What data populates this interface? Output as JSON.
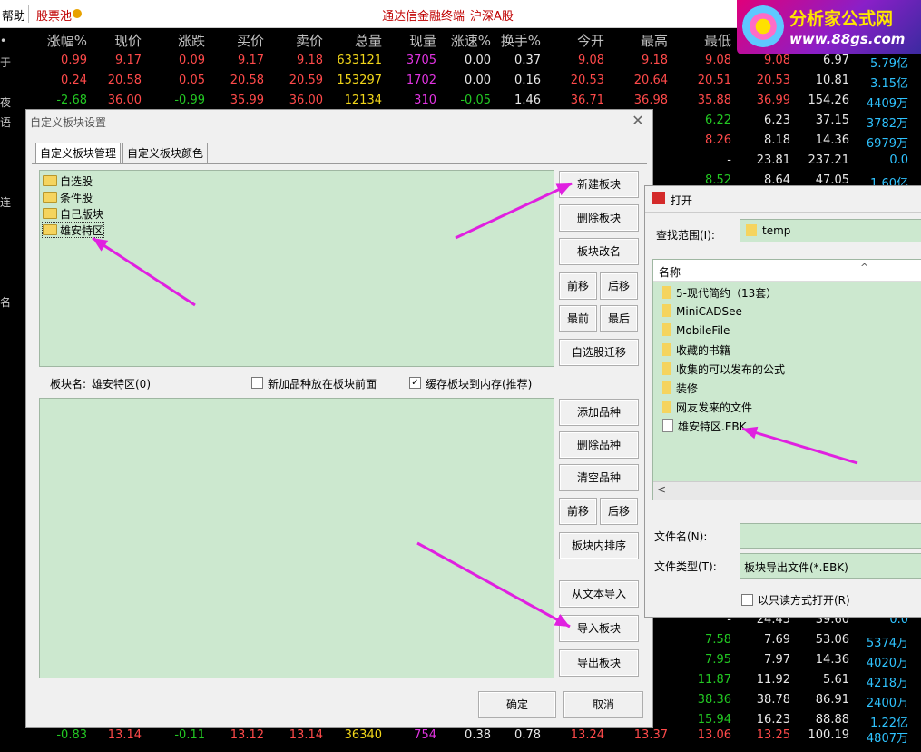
{
  "topbar": {
    "help": "帮助",
    "pool": "股票池",
    "terminal": "通达信金融终端",
    "market": "沪深A股"
  },
  "logo": {
    "line1": "分析家公式网",
    "line2": "www.88gs.com"
  },
  "table": {
    "headers": [
      "涨幅%",
      "现价",
      "涨跌",
      "买价",
      "卖价",
      "总量",
      "现量",
      "涨速%",
      "换手%",
      "今开",
      "最高",
      "最低"
    ],
    "left_stub": [
      "•",
      "于",
      "",
      "夜",
      "语",
      "",
      "",
      "",
      "连",
      "",
      "",
      "",
      "",
      "名",
      "",
      "",
      "",
      "",
      "",
      "",
      "",
      "",
      "",
      "",
      "",
      "",
      "",
      "",
      "",
      "",
      "",
      "",
      ""
    ],
    "rows_top": [
      [
        "0.99",
        "9.17",
        "0.09",
        "9.17",
        "9.18",
        "633121",
        "3705",
        "0.00",
        "0.37",
        "9.08",
        "9.18",
        "9.08",
        "9.08",
        "6.97",
        "5.79亿"
      ],
      [
        "0.24",
        "20.58",
        "0.05",
        "20.58",
        "20.59",
        "153297",
        "1702",
        "0.00",
        "0.16",
        "20.53",
        "20.64",
        "20.51",
        "20.53",
        "10.81",
        "3.15亿"
      ],
      [
        "-2.68",
        "36.00",
        "-0.99",
        "35.99",
        "36.00",
        "12134",
        "310",
        "-0.05",
        "1.46",
        "36.71",
        "36.98",
        "35.88",
        "36.99",
        "154.26",
        "4409万"
      ]
    ],
    "right_rows": [
      [
        "6.22",
        "6.23",
        "37.15",
        "3782万"
      ],
      [
        "8.26",
        "8.18",
        "14.36",
        "6979万"
      ],
      [
        "-",
        "23.81",
        "237.21",
        "0.0"
      ],
      [
        "8.52",
        "8.64",
        "47.05",
        "1.60亿"
      ]
    ],
    "right_rows_bottom": [
      [
        "-",
        "24.45",
        "39.60",
        "0.0"
      ],
      [
        "7.58",
        "7.69",
        "53.06",
        "5374万"
      ],
      [
        "7.95",
        "7.97",
        "14.36",
        "4020万"
      ],
      [
        "11.87",
        "11.92",
        "5.61",
        "4218万"
      ],
      [
        "38.36",
        "38.78",
        "86.91",
        "2400万"
      ],
      [
        "15.94",
        "16.23",
        "88.88",
        "1.22亿"
      ]
    ],
    "bottom_row": [
      "-0.83",
      "13.14",
      "-0.11",
      "13.12",
      "13.14",
      "36340",
      "754",
      "0.38",
      "0.78",
      "13.24",
      "13.37",
      "13.06",
      "13.25",
      "100.19",
      "4807万"
    ]
  },
  "dialog": {
    "title": "自定义板块设置",
    "close": "✕",
    "tabs": [
      "自定义板块管理",
      "自定义板块颜色"
    ],
    "blocks": [
      "自选股",
      "条件股",
      "自己版块",
      "雄安特区"
    ],
    "block_buttons": [
      "新建板块",
      "删除板块",
      "板块改名",
      "前移",
      "后移",
      "最前",
      "最后",
      "自选股迁移"
    ],
    "block_name_label": "板块名:",
    "block_name_value": "雄安特区(0)",
    "option1": "新加品种放在板块前面",
    "option2": "缓存板块到内存(推荐)",
    "option2_checked": "✓",
    "item_buttons": [
      "添加品种",
      "删除品种",
      "清空品种",
      "前移",
      "后移",
      "板块内排序",
      "从文本导入",
      "导入板块",
      "导出板块"
    ],
    "ok": "确定",
    "cancel": "取消"
  },
  "open_dialog": {
    "title": "打开",
    "lookin_label": "查找范围(I):",
    "lookin_value": "temp",
    "col_name": "名称",
    "sort_icon": "^",
    "files": [
      "5-现代简约（13套）",
      "MiniCADSee",
      "MobileFile",
      "收藏的书籍",
      "收集的可以发布的公式",
      "装修",
      "网友发来的文件",
      "雄安特区.EBK"
    ],
    "scroll_left": "<",
    "filename_label": "文件名(N):",
    "filename_value": "",
    "filetype_label": "文件类型(T):",
    "filetype_value": "板块导出文件(*.EBK)",
    "readonly_label": "以只读方式打开(R)"
  },
  "colors": {
    "arrow": "#e020e0",
    "panel": "#cce8cf",
    "up": "#ff4a4a",
    "down": "#23c823"
  }
}
